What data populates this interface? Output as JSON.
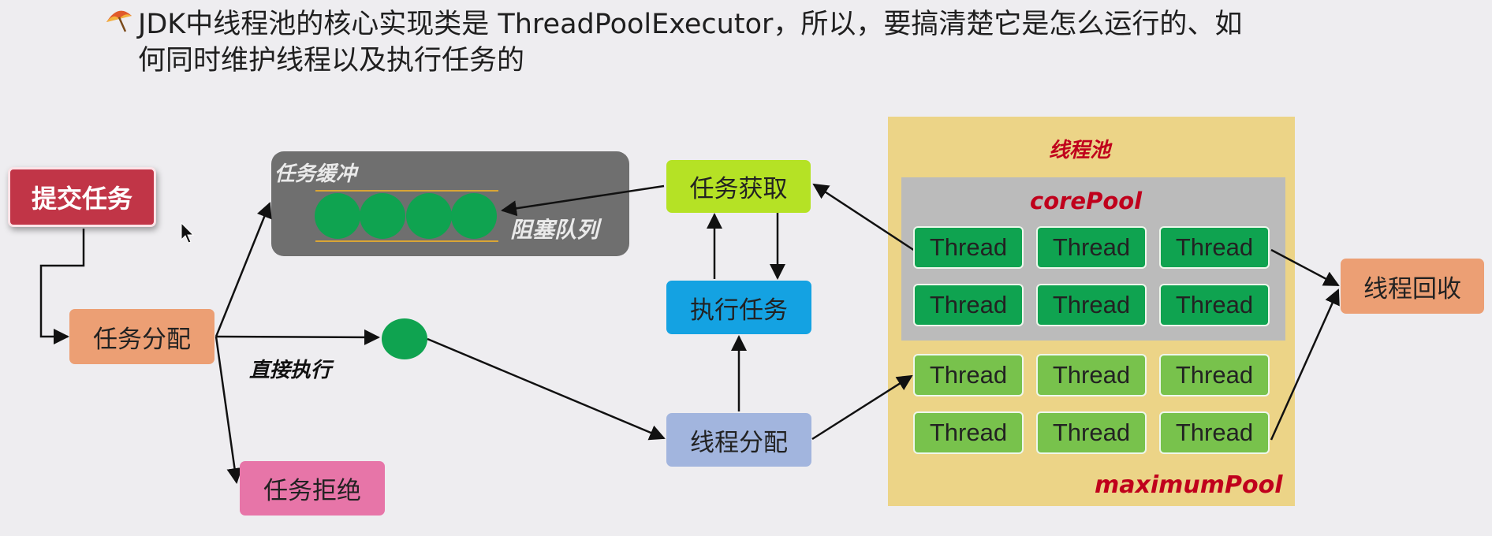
{
  "header": {
    "line1": "JDK中线程池的核心实现类是 ThreadPoolExecutor，所以，要搞清楚它是怎么运行的、如",
    "line2": "何同时维护线程以及执行任务的"
  },
  "nodes": {
    "submit": "提交任务",
    "assign": "任务分配",
    "reject": "任务拒绝",
    "fetch": "任务获取",
    "execute": "执行任务",
    "thread_assign": "线程分配",
    "recycle": "线程回收"
  },
  "buffer": {
    "title": "任务缓冲",
    "queue_label": "阻塞队列"
  },
  "direct_label": "直接执行",
  "pool": {
    "title": "线程池",
    "core_title": "corePool",
    "max_title": "maximumPool",
    "core_threads": [
      "Thread",
      "Thread",
      "Thread",
      "Thread",
      "Thread",
      "Thread"
    ],
    "max_threads": [
      "Thread",
      "Thread",
      "Thread",
      "Thread",
      "Thread",
      "Thread"
    ]
  },
  "colors": {
    "submit": "#c13547",
    "assign": "#ec9f74",
    "reject": "#e775a8",
    "fetch": "#b5e225",
    "execute": "#14a2e2",
    "thread_assign": "#a2b5de",
    "recycle": "#ec9f74",
    "core_thread": "#0fa350",
    "max_thread": "#78c24c",
    "pool_bg": "#ecd487",
    "core_bg": "#bbbbbb",
    "buffer_bg": "#6f6f6f",
    "label_red": "#c0001c"
  },
  "icons": {
    "bullet": "umbrella-bullet-icon",
    "cursor": "mouse-cursor-icon"
  }
}
